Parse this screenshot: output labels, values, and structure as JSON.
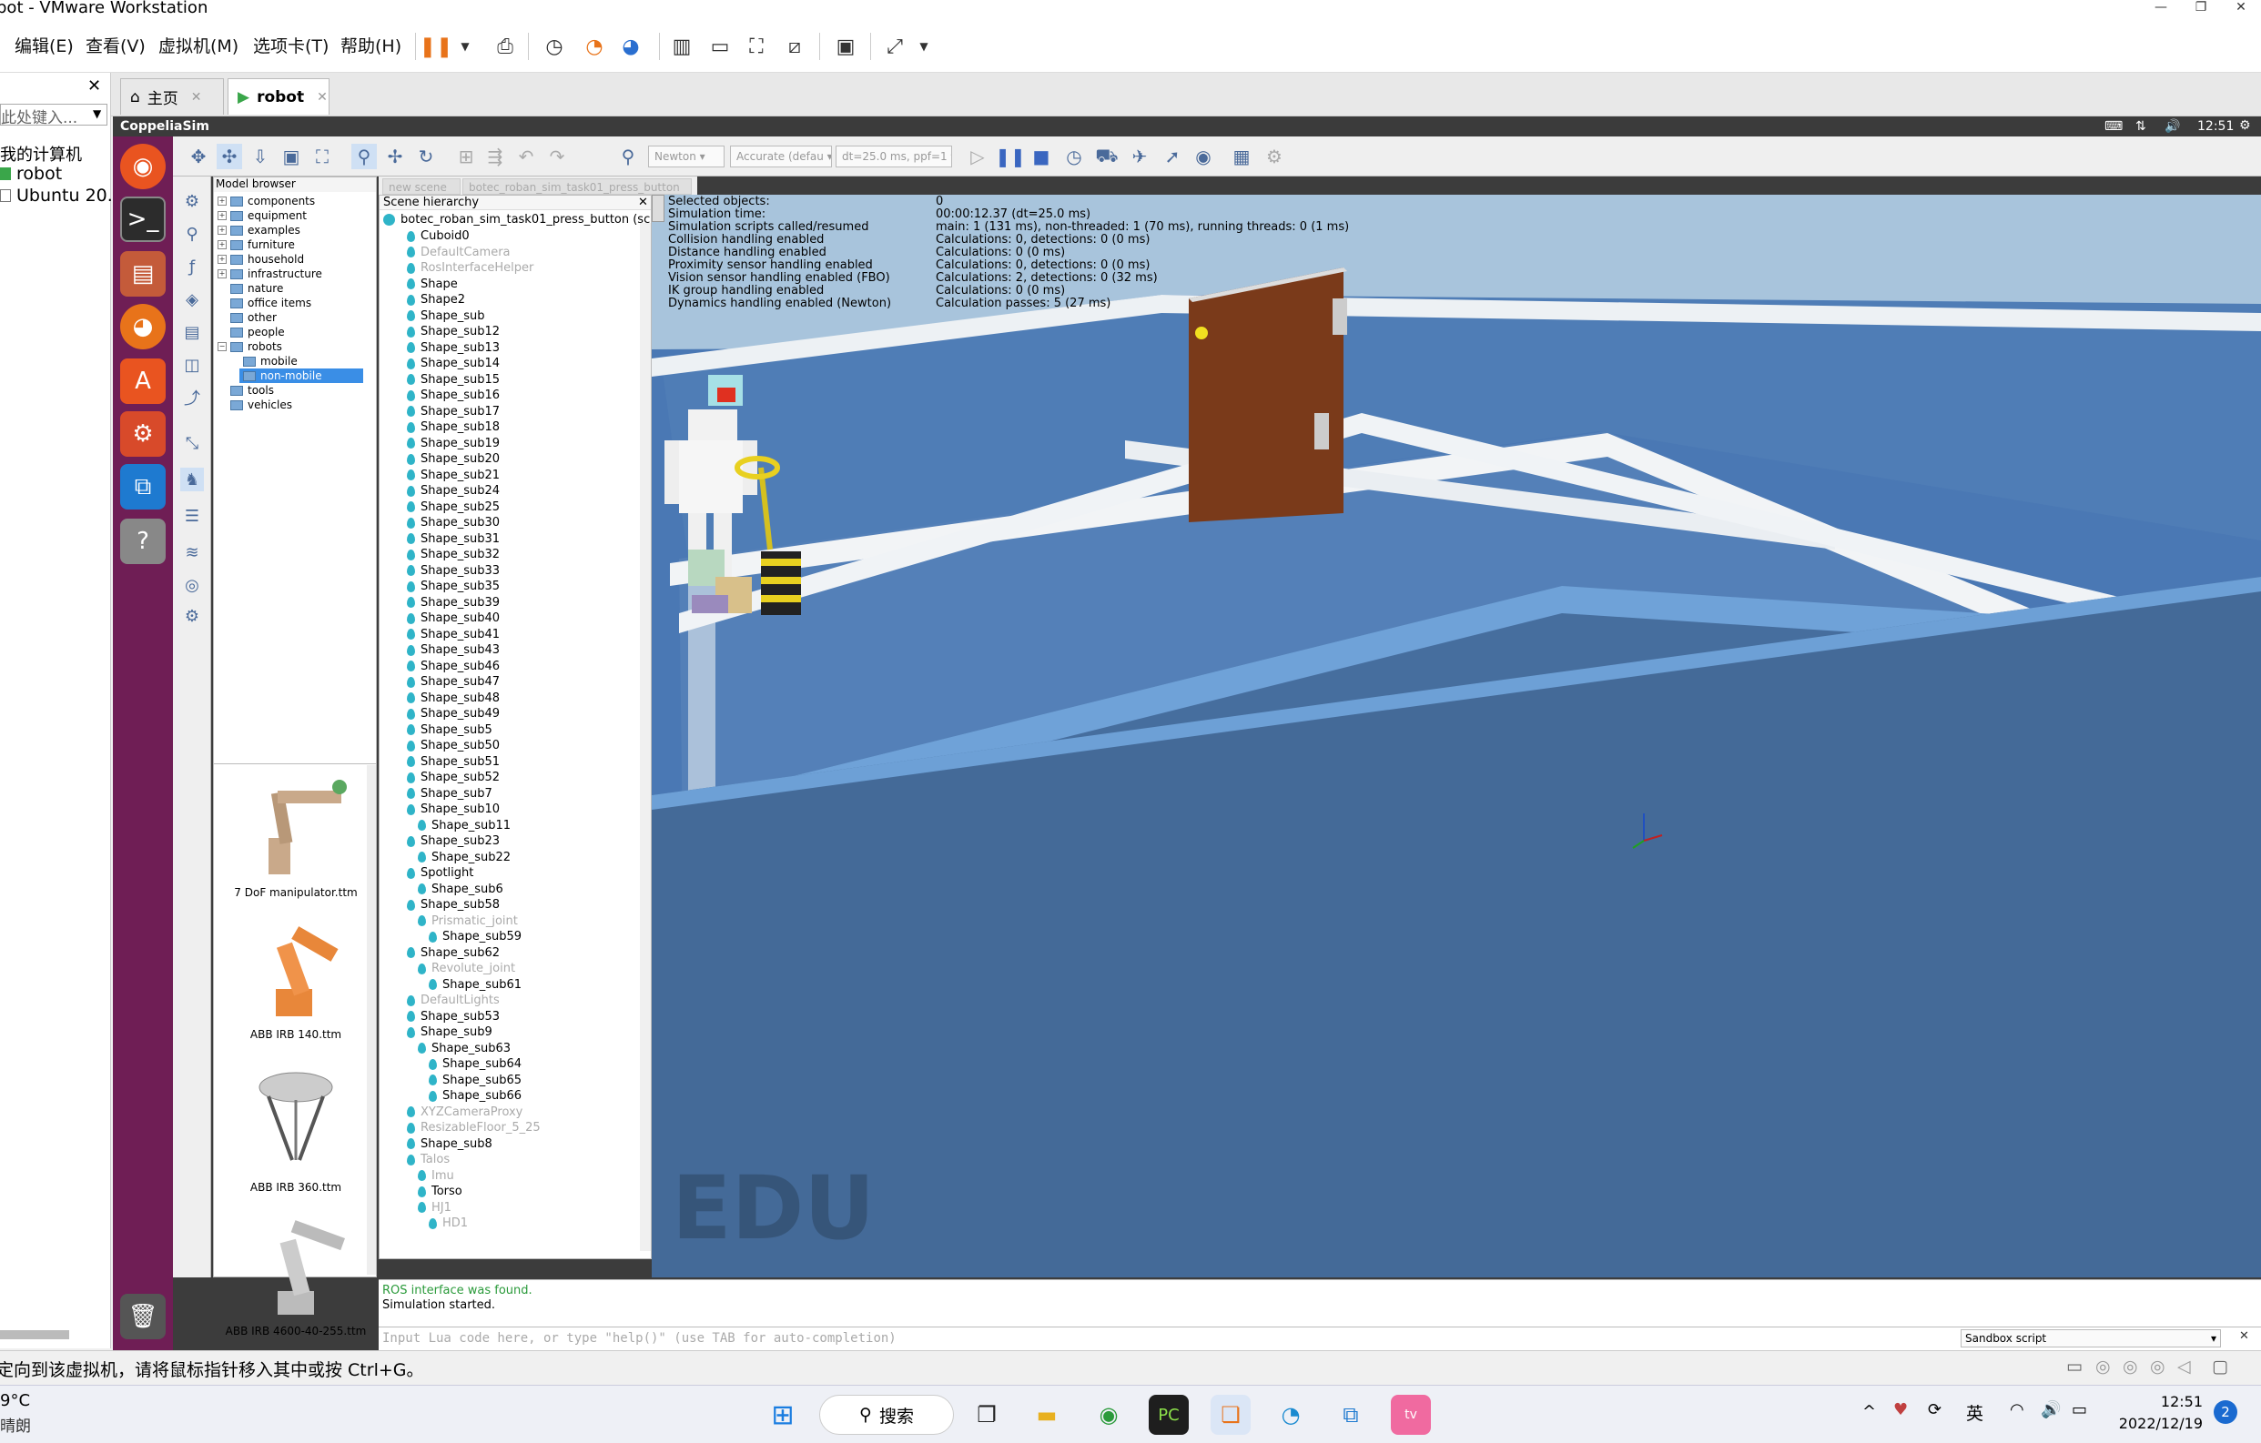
{
  "window": {
    "title": "bot - VMware Workstation",
    "controls": [
      "—",
      "❐",
      "✕"
    ]
  },
  "menubar": {
    "items": [
      "编辑(E)",
      "查看(V)",
      "虚拟机(M)",
      "选项卡(T)",
      "帮助(H)"
    ]
  },
  "library": {
    "search_placeholder": "此处键入...",
    "root": "我的计算机",
    "items": [
      "robot",
      "Ubuntu 20.0"
    ]
  },
  "tabs": [
    {
      "label": "主页"
    },
    {
      "label": "robot"
    }
  ],
  "guest_topbar": {
    "app": "CoppeliaSim",
    "time": "12:51"
  },
  "cs_toolbar": {
    "physics_engine": "Newton",
    "accuracy": "Accurate (defau",
    "timestep": "dt=25.0 ms, ppf=1"
  },
  "model_browser": {
    "title": "Model browser",
    "folders": [
      "components",
      "equipment",
      "examples",
      "furniture",
      "household",
      "infrastructure",
      "nature",
      "office items",
      "other",
      "people",
      "robots",
      "mobile",
      "non-mobile",
      "tools",
      "vehicles"
    ],
    "thumbnails": [
      "7 DoF manipulator.ttm",
      "ABB IRB 140.ttm",
      "ABB IRB 360.ttm",
      "ABB IRB 4600-40-255.ttm"
    ]
  },
  "scene_tabs": [
    "new scene",
    "botec_roban_sim_task01_press_button"
  ],
  "hierarchy": {
    "title": "Scene hierarchy",
    "root": "botec_roban_sim_task01_press_button (sc",
    "rows": [
      {
        "label": "Cuboid0",
        "dim": false,
        "indent": 1
      },
      {
        "label": "DefaultCamera",
        "dim": true,
        "indent": 1
      },
      {
        "label": "RosInterfaceHelper",
        "dim": true,
        "indent": 1
      },
      {
        "label": "Shape",
        "dim": false,
        "indent": 1
      },
      {
        "label": "Shape2",
        "dim": false,
        "indent": 1
      },
      {
        "label": "Shape_sub",
        "dim": false,
        "indent": 1
      },
      {
        "label": "Shape_sub12",
        "dim": false,
        "indent": 1
      },
      {
        "label": "Shape_sub13",
        "dim": false,
        "indent": 1
      },
      {
        "label": "Shape_sub14",
        "dim": false,
        "indent": 1
      },
      {
        "label": "Shape_sub15",
        "dim": false,
        "indent": 1
      },
      {
        "label": "Shape_sub16",
        "dim": false,
        "indent": 1
      },
      {
        "label": "Shape_sub17",
        "dim": false,
        "indent": 1
      },
      {
        "label": "Shape_sub18",
        "dim": false,
        "indent": 1
      },
      {
        "label": "Shape_sub19",
        "dim": false,
        "indent": 1
      },
      {
        "label": "Shape_sub20",
        "dim": false,
        "indent": 1
      },
      {
        "label": "Shape_sub21",
        "dim": false,
        "indent": 1
      },
      {
        "label": "Shape_sub24",
        "dim": false,
        "indent": 1
      },
      {
        "label": "Shape_sub25",
        "dim": false,
        "indent": 1
      },
      {
        "label": "Shape_sub30",
        "dim": false,
        "indent": 1
      },
      {
        "label": "Shape_sub31",
        "dim": false,
        "indent": 1
      },
      {
        "label": "Shape_sub32",
        "dim": false,
        "indent": 1
      },
      {
        "label": "Shape_sub33",
        "dim": false,
        "indent": 1
      },
      {
        "label": "Shape_sub35",
        "dim": false,
        "indent": 1
      },
      {
        "label": "Shape_sub39",
        "dim": false,
        "indent": 1
      },
      {
        "label": "Shape_sub40",
        "dim": false,
        "indent": 1
      },
      {
        "label": "Shape_sub41",
        "dim": false,
        "indent": 1
      },
      {
        "label": "Shape_sub43",
        "dim": false,
        "indent": 1
      },
      {
        "label": "Shape_sub46",
        "dim": false,
        "indent": 1
      },
      {
        "label": "Shape_sub47",
        "dim": false,
        "indent": 1
      },
      {
        "label": "Shape_sub48",
        "dim": false,
        "indent": 1
      },
      {
        "label": "Shape_sub49",
        "dim": false,
        "indent": 1
      },
      {
        "label": "Shape_sub5",
        "dim": false,
        "indent": 1
      },
      {
        "label": "Shape_sub50",
        "dim": false,
        "indent": 1
      },
      {
        "label": "Shape_sub51",
        "dim": false,
        "indent": 1
      },
      {
        "label": "Shape_sub52",
        "dim": false,
        "indent": 1
      },
      {
        "label": "Shape_sub7",
        "dim": false,
        "indent": 1
      },
      {
        "label": "Shape_sub10",
        "dim": false,
        "indent": 1
      },
      {
        "label": "Shape_sub11",
        "dim": false,
        "indent": 2
      },
      {
        "label": "Shape_sub23",
        "dim": false,
        "indent": 1
      },
      {
        "label": "Shape_sub22",
        "dim": false,
        "indent": 2
      },
      {
        "label": "Spotlight",
        "dim": false,
        "indent": 1
      },
      {
        "label": "Shape_sub6",
        "dim": false,
        "indent": 2
      },
      {
        "label": "Shape_sub58",
        "dim": false,
        "indent": 1
      },
      {
        "label": "Prismatic_joint",
        "dim": true,
        "indent": 2
      },
      {
        "label": "Shape_sub59",
        "dim": false,
        "indent": 3
      },
      {
        "label": "Shape_sub62",
        "dim": false,
        "indent": 1
      },
      {
        "label": "Revolute_joint",
        "dim": true,
        "indent": 2
      },
      {
        "label": "Shape_sub61",
        "dim": false,
        "indent": 3
      },
      {
        "label": "DefaultLights",
        "dim": true,
        "indent": 1
      },
      {
        "label": "Shape_sub53",
        "dim": false,
        "indent": 1
      },
      {
        "label": "Shape_sub9",
        "dim": false,
        "indent": 1
      },
      {
        "label": "Shape_sub63",
        "dim": false,
        "indent": 2
      },
      {
        "label": "Shape_sub64",
        "dim": false,
        "indent": 3
      },
      {
        "label": "Shape_sub65",
        "dim": false,
        "indent": 3
      },
      {
        "label": "Shape_sub66",
        "dim": false,
        "indent": 3
      },
      {
        "label": "XYZCameraProxy",
        "dim": true,
        "indent": 1
      },
      {
        "label": "ResizableFloor_5_25",
        "dim": true,
        "indent": 1
      },
      {
        "label": "Shape_sub8",
        "dim": false,
        "indent": 1
      },
      {
        "label": "Talos",
        "dim": true,
        "indent": 1
      },
      {
        "label": "Imu",
        "dim": true,
        "indent": 2
      },
      {
        "label": "Torso",
        "dim": false,
        "indent": 2
      },
      {
        "label": "HJ1",
        "dim": true,
        "indent": 2
      },
      {
        "label": "HD1",
        "dim": true,
        "indent": 3
      }
    ]
  },
  "info_overlay": {
    "labels": [
      "Selected objects:",
      "Simulation time:",
      "Simulation scripts called/resumed",
      "Collision handling enabled",
      "Distance handling enabled",
      "Proximity sensor handling enabled",
      "Vision sensor handling enabled (FBO)",
      "IK group handling enabled",
      "Dynamics handling enabled (Newton)"
    ],
    "values": [
      "0",
      "00:00:12.37 (dt=25.0 ms)",
      "main: 1 (131 ms), non-threaded: 1 (70 ms), running threads: 0 (1 ms)",
      "Calculations: 0, detections: 0 (0 ms)",
      "Calculations: 0 (0 ms)",
      "Calculations: 0, detections: 0 (0 ms)",
      "Calculations: 2, detections: 0 (32 ms)",
      "Calculations: 0 (0 ms)",
      "Calculation passes: 5 (27 ms)"
    ]
  },
  "viewport": {
    "watermark": "EDU"
  },
  "status": {
    "line1": "ROS interface was found.",
    "line2": "Simulation started.",
    "lua_placeholder": "Input Lua code here, or type \"help()\" (use TAB for auto-completion)",
    "script_select": "Sandbox script"
  },
  "vm_status": {
    "message": "定向到该虚拟机，请将鼠标指针移入其中或按 Ctrl+G。"
  },
  "taskbar": {
    "weather_temp": "9°C",
    "weather_desc": "晴朗",
    "search": "搜索",
    "lang": "英",
    "time": "12:51",
    "date": "2022/12/19",
    "notifications": "2"
  }
}
